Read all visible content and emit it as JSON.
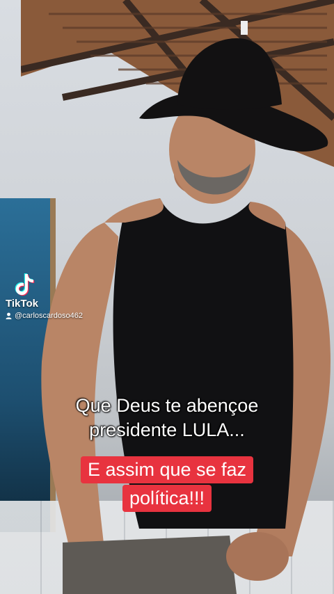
{
  "watermark": {
    "brand": "TikTok",
    "handle": "@carloscardoso462",
    "logo_icon": "tiktok-logo-icon",
    "user_icon": "user-icon"
  },
  "captions": {
    "line1": "Que Deus te abençoe",
    "line2": "presidente LULA...",
    "highlight_line1": "E assim que se faz",
    "highlight_line2": "política!!!",
    "highlight_color": "#e8333f"
  }
}
